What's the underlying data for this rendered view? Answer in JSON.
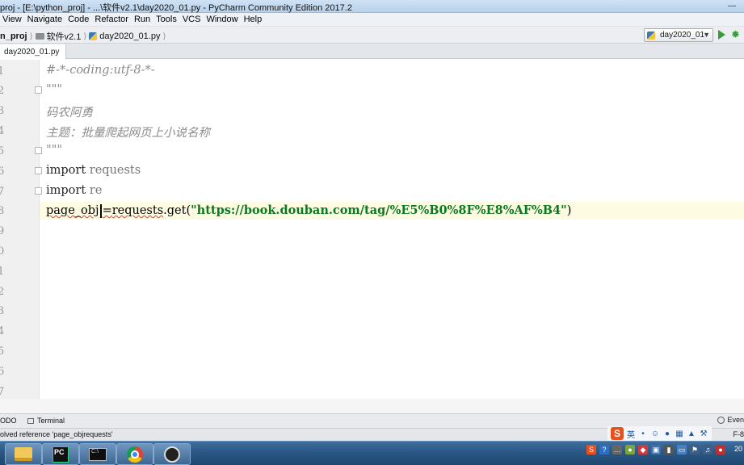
{
  "window": {
    "title": "proj - [E:\\python_proj] - ...\\软件v2.1\\day2020_01.py - PyCharm Community Edition 2017.2"
  },
  "menu": [
    "View",
    "Navigate",
    "Code",
    "Refactor",
    "Run",
    "Tools",
    "VCS",
    "Window",
    "Help"
  ],
  "breadcrumbs": {
    "project": "n_proj",
    "folder": "软件v2.1",
    "file": "day2020_01.py"
  },
  "run_config": {
    "label": "day2020_01"
  },
  "tabs": [
    {
      "label": "day2020_01.py"
    }
  ],
  "editor": {
    "line_numbers": [
      "1",
      "2",
      "3",
      "4",
      "5",
      "6",
      "7",
      "8",
      "9",
      "0",
      "1",
      "2",
      "3",
      "4",
      "5",
      "6",
      "7"
    ],
    "lines": {
      "l1": "#-*-coding:utf-8-*-",
      "l2": "\"\"\"",
      "l3": "码农阿勇",
      "l4": "主题：批量爬起网页上小说名称",
      "l5": "\"\"\"",
      "l6_kw": "import",
      "l6_mod": "requests",
      "l7_kw": "import",
      "l7_mod": "re",
      "l8_var": "page_obj",
      "l8_eq": "=",
      "l8_ref": "requests",
      "l8_call": ".get(",
      "l8_str": "\"https://book.douban.com/tag/%E5%B0%8F%E8%AF%B4\"",
      "l8_close": ")"
    }
  },
  "toolwindows": {
    "todo": "ODO",
    "terminal": "Terminal",
    "event_log": "Even"
  },
  "status": {
    "message": "olved reference 'page_objrequests'",
    "encoding": "F-8"
  },
  "ime": {
    "lang": "英"
  },
  "taskbar": {
    "clock": "20"
  }
}
